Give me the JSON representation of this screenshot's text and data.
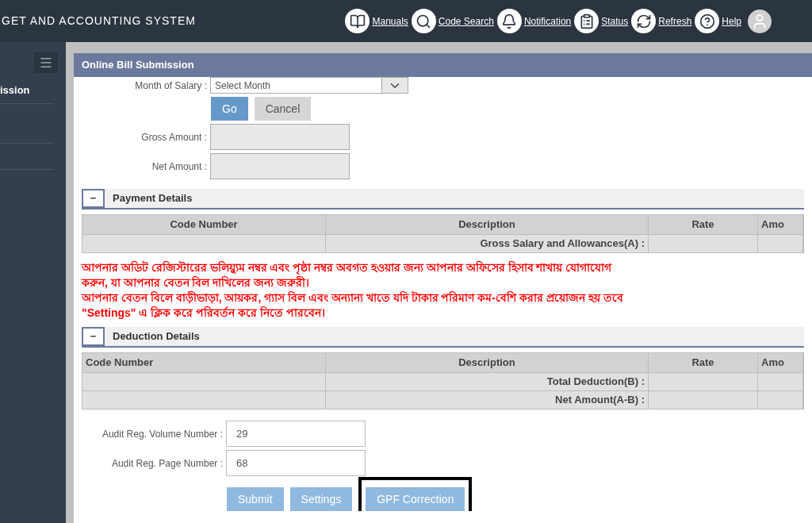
{
  "header": {
    "title": "GET AND ACCOUNTING SYSTEM",
    "links": [
      {
        "kind": "manuals",
        "label": "Manuals"
      },
      {
        "kind": "search",
        "label": "Code Search"
      },
      {
        "kind": "bell",
        "label": "Notification"
      },
      {
        "kind": "status",
        "label": "Status"
      },
      {
        "kind": "refresh",
        "label": "Refresh"
      },
      {
        "kind": "help",
        "label": "Help"
      }
    ]
  },
  "sidebar": {
    "items": [
      {
        "label": "ission"
      }
    ]
  },
  "panel": {
    "title": "Online Bill Submission",
    "month": {
      "label": "Month of Salary :",
      "value": "Select Month"
    },
    "actions": [
      {
        "label": "Go",
        "kind": "primary"
      },
      {
        "label": "Cancel",
        "kind": "secondary"
      }
    ],
    "amounts": [
      {
        "label": "Gross Amount :"
      },
      {
        "label": "Net Amount :"
      }
    ],
    "payment": {
      "toggle": "−",
      "title": "Payment Details",
      "columns": [
        "Code Number",
        "Description",
        "Rate",
        "Amo"
      ],
      "rows": [
        [
          "",
          "Gross Salary and Allowances(A) :",
          "",
          ""
        ]
      ]
    },
    "notice": [
      "আপনার অডিট রেজিস্টারের ভলিয়্যুম নম্বর এবং পৃষ্ঠা নম্বর অবগত হওয়ার জন্য আপনার অফিসের হিসাব শাখায় যোগাযোগ করুন, যা আপনার বেতন বিল দাখিলের জন্য জরুরী।",
      "আপনার বেতন বিলে বাড়ীভাড়া, আয়কর, গ্যাস বিল এবং অন্যান্য খাতে যদি টাকার পরিমাণ কম-বেশি করার প্রয়োজন হয় তবে \"Settings\" এ ক্লিক করে পরিবর্তন করে নিতে পারবেন।"
    ],
    "deduction": {
      "toggle": "−",
      "title": "Deduction Details",
      "columns": [
        "Code Number",
        "Description",
        "Rate",
        "Amo"
      ],
      "rows": [
        [
          "",
          "Total Deduction(B) :",
          "",
          ""
        ],
        [
          "",
          "Net Amount(A-B) :",
          "",
          ""
        ]
      ]
    },
    "audit": [
      {
        "label": "Audit Reg. Volume Number :",
        "value": "29"
      },
      {
        "label": "Audit Reg. Page Number :",
        "value": "68"
      }
    ],
    "buttons": [
      {
        "label": "Submit",
        "highlighted": false
      },
      {
        "label": "Settings",
        "highlighted": false
      },
      {
        "label": "GPF Correction",
        "highlighted": true
      }
    ]
  }
}
